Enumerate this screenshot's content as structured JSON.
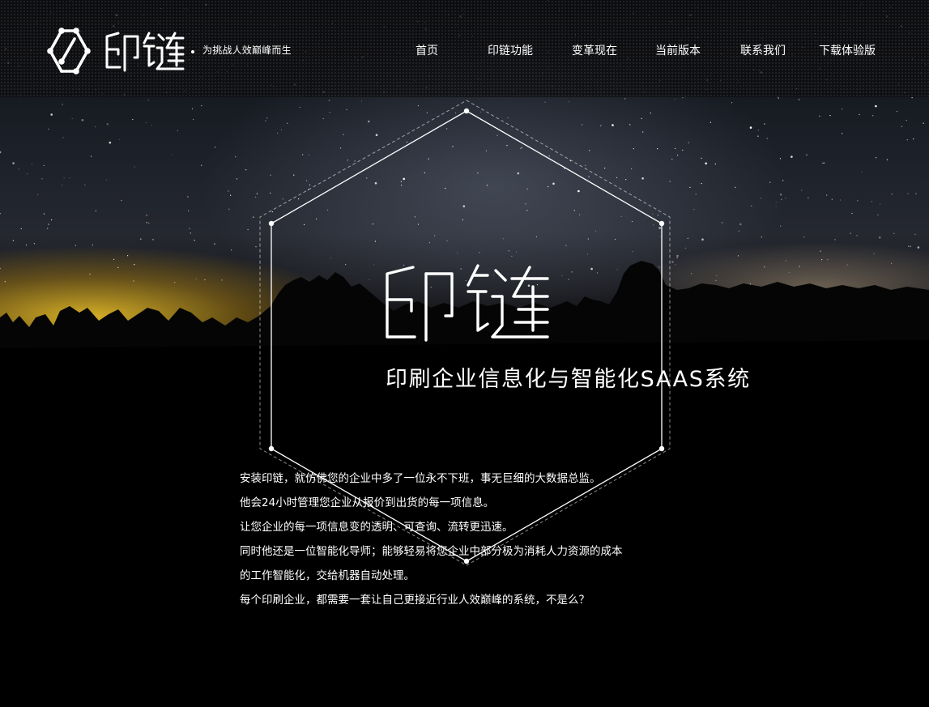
{
  "header": {
    "logo_text": "印链",
    "tagline": "为挑战人效巅峰而生",
    "nav": [
      {
        "label": "首页"
      },
      {
        "label": "印链功能"
      },
      {
        "label": "变革现在"
      },
      {
        "label": "当前版本"
      },
      {
        "label": "联系我们"
      },
      {
        "label": "下载体验版"
      }
    ]
  },
  "hero": {
    "title": "印链",
    "subtitle": "印刷企业信息化与智能化SAAS系统",
    "paragraph_lines": [
      "安装印链，就仿佛您的企业中多了一位永不下班，事无巨细的大数据总监。",
      "他会24小时管理您企业从报价到出货的每一项信息。",
      "让您企业的每一项信息变的透明、可查询、流转更迅速。",
      "同时他还是一位智能化导师；能够轻易将您企业中部分极为消耗人力资源的成本",
      "的工作智能化，交给机器自动处理。",
      "每个印刷企业，都需要一套让自己更接近行业人效巅峰的系统，不是么？"
    ]
  },
  "colors": {
    "background": "#000000",
    "text": "#ffffff",
    "horizon_glow": "#e1b928"
  },
  "icons": {
    "logo": "chain-hexagon-logo-icon"
  }
}
